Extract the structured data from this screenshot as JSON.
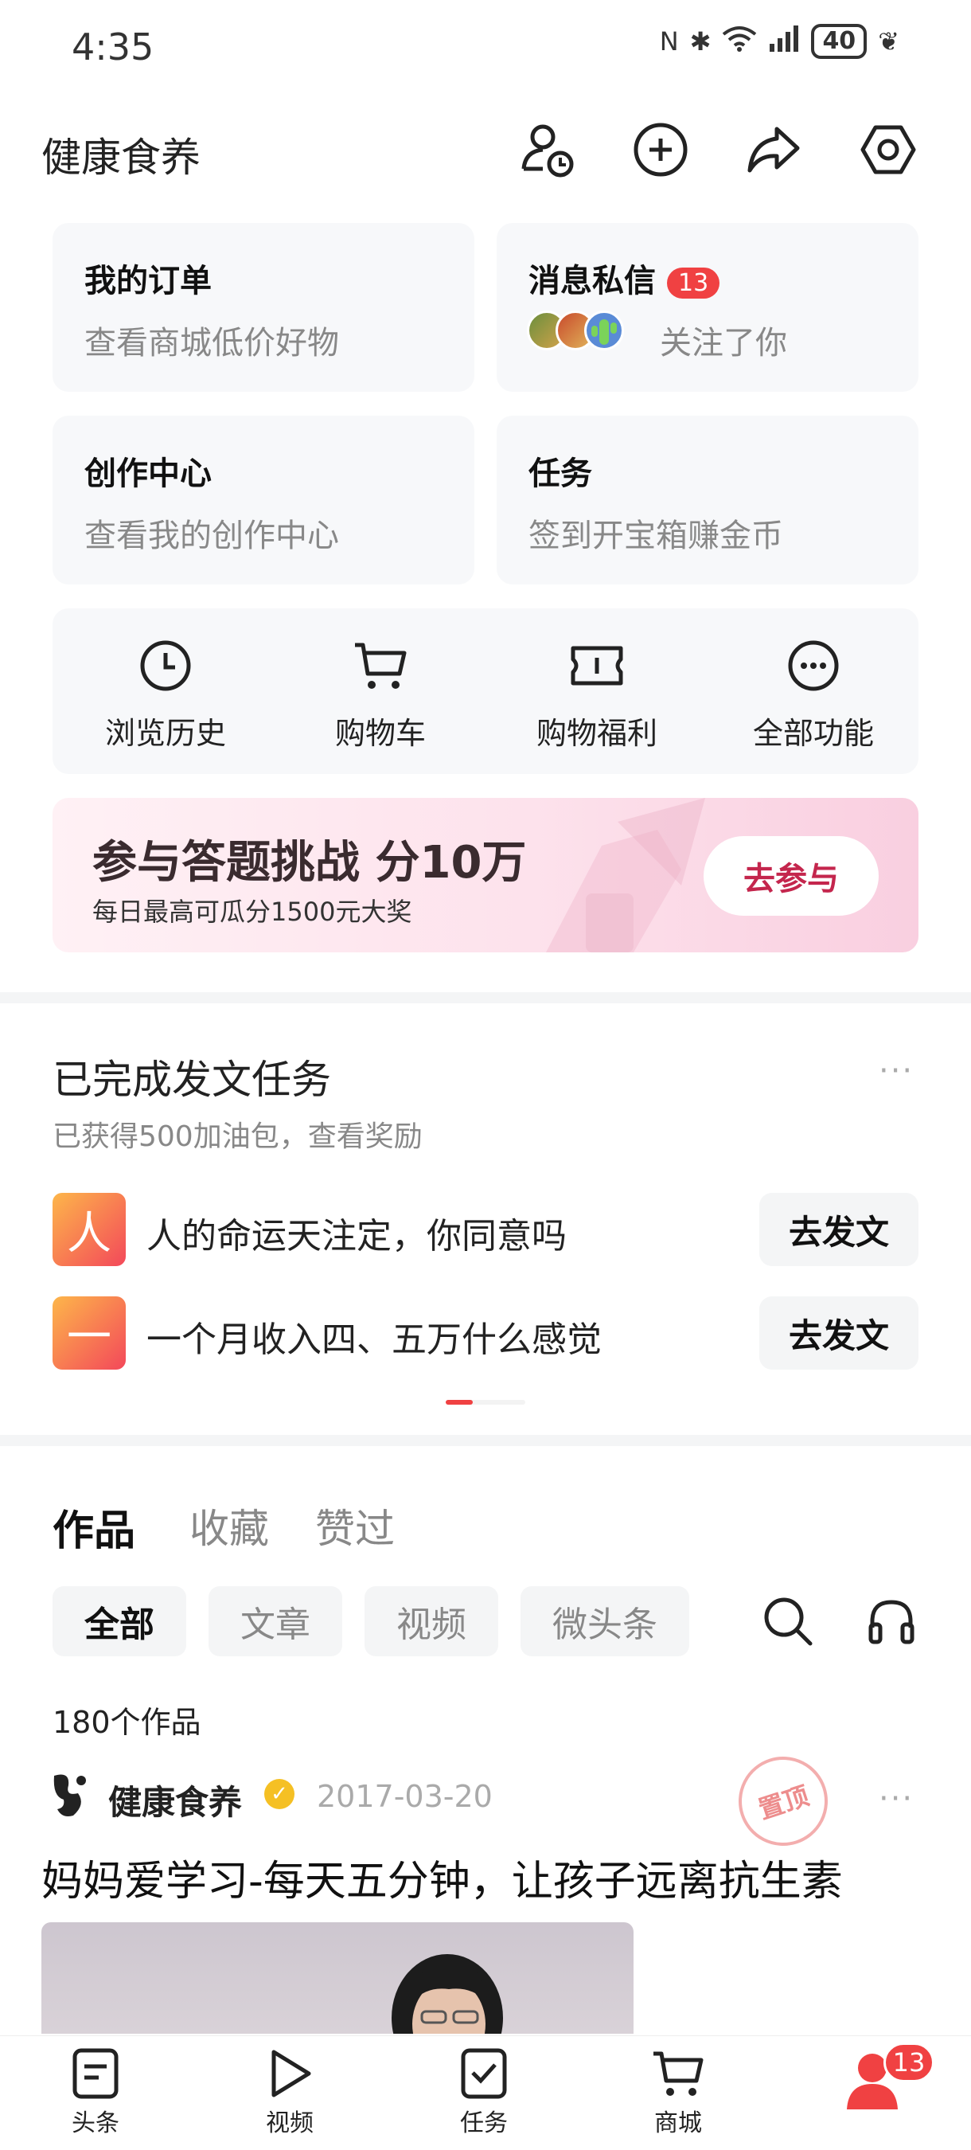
{
  "status": {
    "time": "4:35",
    "battery": "40"
  },
  "header": {
    "title": "健康食养"
  },
  "cards": {
    "orders": {
      "title": "我的订单",
      "sub": "查看商城低价好物"
    },
    "messages": {
      "title": "消息私信",
      "badge": "13",
      "sub": "关注了你"
    },
    "creator": {
      "title": "创作中心",
      "sub": "查看我的创作中心"
    },
    "tasks": {
      "title": "任务",
      "sub": "签到开宝箱赚金币"
    }
  },
  "functions": [
    {
      "label": "浏览历史",
      "icon": "clock-icon"
    },
    {
      "label": "购物车",
      "icon": "cart-icon"
    },
    {
      "label": "购物福利",
      "icon": "ticket-icon"
    },
    {
      "label": "全部功能",
      "icon": "more-icon"
    }
  ],
  "banner": {
    "title": "参与答题挑战 分10万",
    "sub": "每日最高可瓜分1500元大奖",
    "button": "去参与"
  },
  "task_section": {
    "title": "已完成发文任务",
    "sub": "已获得500加油包，查看奖励",
    "items": [
      {
        "icon_char": "人",
        "text": "人的命运天注定，你同意吗",
        "button": "去发文"
      },
      {
        "icon_char": "一",
        "text": "一个月收入四、五万什么感觉",
        "button": "去发文"
      }
    ]
  },
  "works": {
    "tabs": [
      "作品",
      "收藏",
      "赞过"
    ],
    "chips": [
      "全部",
      "文章",
      "视频",
      "微头条"
    ],
    "count": "180个作品"
  },
  "post": {
    "author": "健康食养",
    "date": "2017-03-20",
    "title": "妈妈爱学习-每天五分钟，让孩子远离抗生素",
    "pin_stamp": "置顶"
  },
  "bottom_nav": {
    "items": [
      "头条",
      "视频",
      "任务",
      "商城"
    ],
    "me_badge": "13"
  },
  "colors": {
    "accent_red": "#f04142",
    "banner_button": "#c4264d"
  }
}
